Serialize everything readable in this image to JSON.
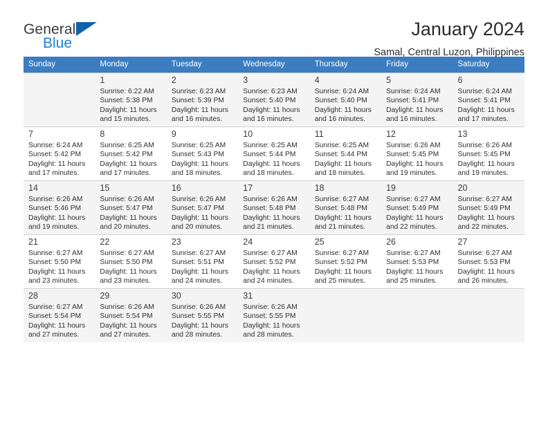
{
  "brand": {
    "name_top": "General",
    "name_bottom": "Blue",
    "flag_icon": "blue-triangle-flag",
    "accent_color": "#1d7fd4",
    "flag_color": "#1162a8"
  },
  "header": {
    "title": "January 2024",
    "subtitle": "Samal, Central Luzon, Philippines"
  },
  "calendar": {
    "header_bg": "#3b7dc0",
    "weekday_headers": [
      "Sunday",
      "Monday",
      "Tuesday",
      "Wednesday",
      "Thursday",
      "Friday",
      "Saturday"
    ],
    "weeks": [
      [
        {
          "day": "",
          "info": ""
        },
        {
          "day": "1",
          "info": "Sunrise: 6:22 AM\nSunset: 5:38 PM\nDaylight: 11 hours\nand 15 minutes."
        },
        {
          "day": "2",
          "info": "Sunrise: 6:23 AM\nSunset: 5:39 PM\nDaylight: 11 hours\nand 16 minutes."
        },
        {
          "day": "3",
          "info": "Sunrise: 6:23 AM\nSunset: 5:40 PM\nDaylight: 11 hours\nand 16 minutes."
        },
        {
          "day": "4",
          "info": "Sunrise: 6:24 AM\nSunset: 5:40 PM\nDaylight: 11 hours\nand 16 minutes."
        },
        {
          "day": "5",
          "info": "Sunrise: 6:24 AM\nSunset: 5:41 PM\nDaylight: 11 hours\nand 16 minutes."
        },
        {
          "day": "6",
          "info": "Sunrise: 6:24 AM\nSunset: 5:41 PM\nDaylight: 11 hours\nand 17 minutes."
        }
      ],
      [
        {
          "day": "7",
          "info": "Sunrise: 6:24 AM\nSunset: 5:42 PM\nDaylight: 11 hours\nand 17 minutes."
        },
        {
          "day": "8",
          "info": "Sunrise: 6:25 AM\nSunset: 5:42 PM\nDaylight: 11 hours\nand 17 minutes."
        },
        {
          "day": "9",
          "info": "Sunrise: 6:25 AM\nSunset: 5:43 PM\nDaylight: 11 hours\nand 18 minutes."
        },
        {
          "day": "10",
          "info": "Sunrise: 6:25 AM\nSunset: 5:44 PM\nDaylight: 11 hours\nand 18 minutes."
        },
        {
          "day": "11",
          "info": "Sunrise: 6:25 AM\nSunset: 5:44 PM\nDaylight: 11 hours\nand 18 minutes."
        },
        {
          "day": "12",
          "info": "Sunrise: 6:26 AM\nSunset: 5:45 PM\nDaylight: 11 hours\nand 19 minutes."
        },
        {
          "day": "13",
          "info": "Sunrise: 6:26 AM\nSunset: 5:45 PM\nDaylight: 11 hours\nand 19 minutes."
        }
      ],
      [
        {
          "day": "14",
          "info": "Sunrise: 6:26 AM\nSunset: 5:46 PM\nDaylight: 11 hours\nand 19 minutes."
        },
        {
          "day": "15",
          "info": "Sunrise: 6:26 AM\nSunset: 5:47 PM\nDaylight: 11 hours\nand 20 minutes."
        },
        {
          "day": "16",
          "info": "Sunrise: 6:26 AM\nSunset: 5:47 PM\nDaylight: 11 hours\nand 20 minutes."
        },
        {
          "day": "17",
          "info": "Sunrise: 6:26 AM\nSunset: 5:48 PM\nDaylight: 11 hours\nand 21 minutes."
        },
        {
          "day": "18",
          "info": "Sunrise: 6:27 AM\nSunset: 5:48 PM\nDaylight: 11 hours\nand 21 minutes."
        },
        {
          "day": "19",
          "info": "Sunrise: 6:27 AM\nSunset: 5:49 PM\nDaylight: 11 hours\nand 22 minutes."
        },
        {
          "day": "20",
          "info": "Sunrise: 6:27 AM\nSunset: 5:49 PM\nDaylight: 11 hours\nand 22 minutes."
        }
      ],
      [
        {
          "day": "21",
          "info": "Sunrise: 6:27 AM\nSunset: 5:50 PM\nDaylight: 11 hours\nand 23 minutes."
        },
        {
          "day": "22",
          "info": "Sunrise: 6:27 AM\nSunset: 5:50 PM\nDaylight: 11 hours\nand 23 minutes."
        },
        {
          "day": "23",
          "info": "Sunrise: 6:27 AM\nSunset: 5:51 PM\nDaylight: 11 hours\nand 24 minutes."
        },
        {
          "day": "24",
          "info": "Sunrise: 6:27 AM\nSunset: 5:52 PM\nDaylight: 11 hours\nand 24 minutes."
        },
        {
          "day": "25",
          "info": "Sunrise: 6:27 AM\nSunset: 5:52 PM\nDaylight: 11 hours\nand 25 minutes."
        },
        {
          "day": "26",
          "info": "Sunrise: 6:27 AM\nSunset: 5:53 PM\nDaylight: 11 hours\nand 25 minutes."
        },
        {
          "day": "27",
          "info": "Sunrise: 6:27 AM\nSunset: 5:53 PM\nDaylight: 11 hours\nand 26 minutes."
        }
      ],
      [
        {
          "day": "28",
          "info": "Sunrise: 6:27 AM\nSunset: 5:54 PM\nDaylight: 11 hours\nand 27 minutes."
        },
        {
          "day": "29",
          "info": "Sunrise: 6:26 AM\nSunset: 5:54 PM\nDaylight: 11 hours\nand 27 minutes."
        },
        {
          "day": "30",
          "info": "Sunrise: 6:26 AM\nSunset: 5:55 PM\nDaylight: 11 hours\nand 28 minutes."
        },
        {
          "day": "31",
          "info": "Sunrise: 6:26 AM\nSunset: 5:55 PM\nDaylight: 11 hours\nand 28 minutes."
        },
        {
          "day": "",
          "info": ""
        },
        {
          "day": "",
          "info": ""
        },
        {
          "day": "",
          "info": ""
        }
      ]
    ]
  }
}
